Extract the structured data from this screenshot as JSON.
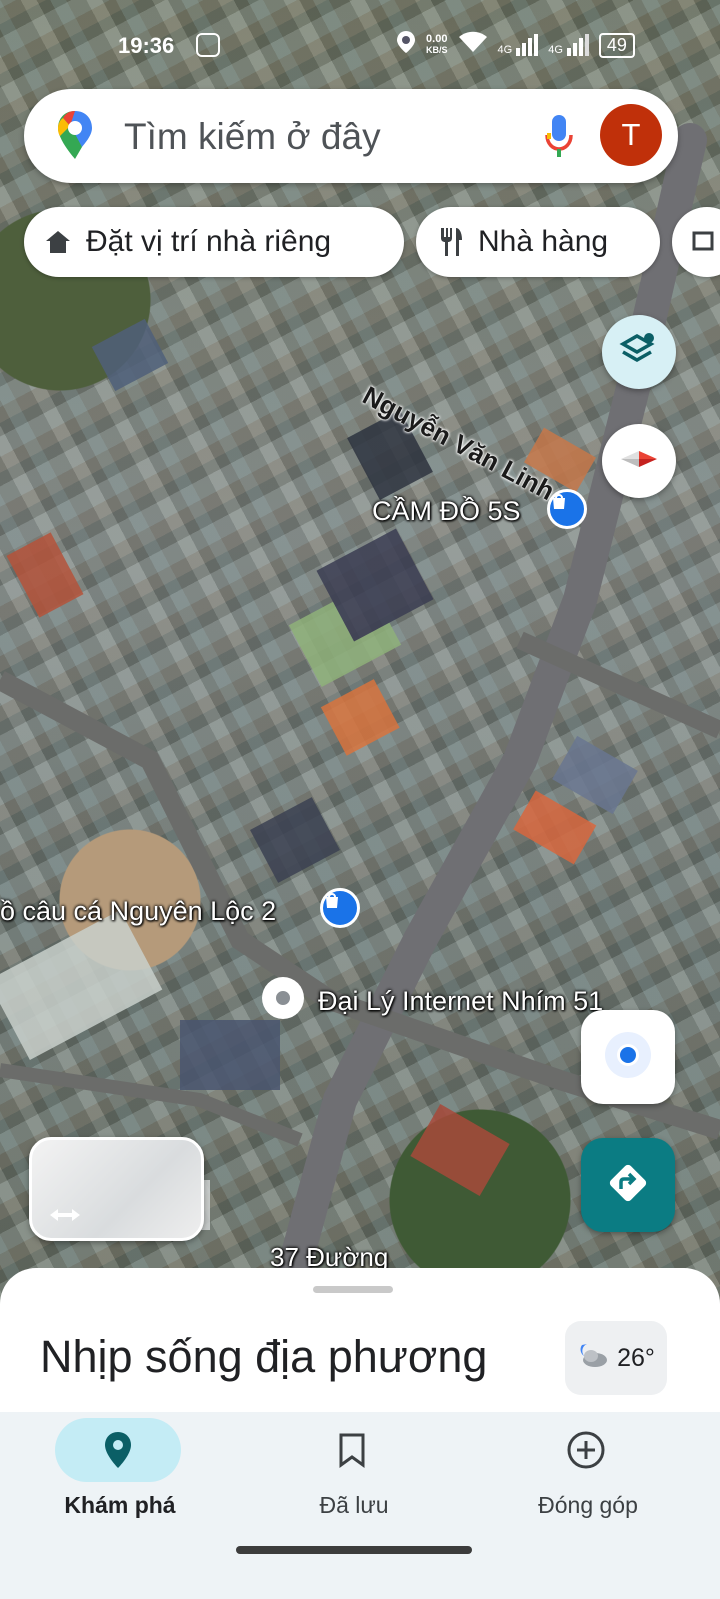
{
  "status_bar": {
    "time": "19:36",
    "speed": "0.00",
    "speed_unit": "KB/S",
    "signal1": "4G",
    "signal2": "4G",
    "battery": "49"
  },
  "search": {
    "placeholder": "Tìm kiếm ở đây",
    "avatar_letter": "T"
  },
  "chips": {
    "home_label": "Đặt vị trí nhà riêng",
    "restaurant_label": "Nhà hàng"
  },
  "map": {
    "street_label": "Nguyễn Văn Linh",
    "places": {
      "cam_do": "CẦM ĐỒ 5S",
      "cau_ca": "ồ câu cá Nguyên Lộc 2",
      "internet": "Đại Lý Internet Nhím 51",
      "duong": "37 Đường"
    }
  },
  "sheet": {
    "title": "Nhịp sống địa phương",
    "temperature": "26°"
  },
  "nav": {
    "items": [
      {
        "label": "Khám phá",
        "icon": "place-pin-icon",
        "active": true
      },
      {
        "label": "Đã lưu",
        "icon": "bookmark-icon",
        "active": false
      },
      {
        "label": "Đóng góp",
        "icon": "add-circle-icon",
        "active": false
      }
    ]
  },
  "colors": {
    "accent_teal": "#0b7c83",
    "avatar_bg": "#c0300a",
    "active_pill": "#c4ecf5",
    "location_blue": "#1a73e8"
  }
}
